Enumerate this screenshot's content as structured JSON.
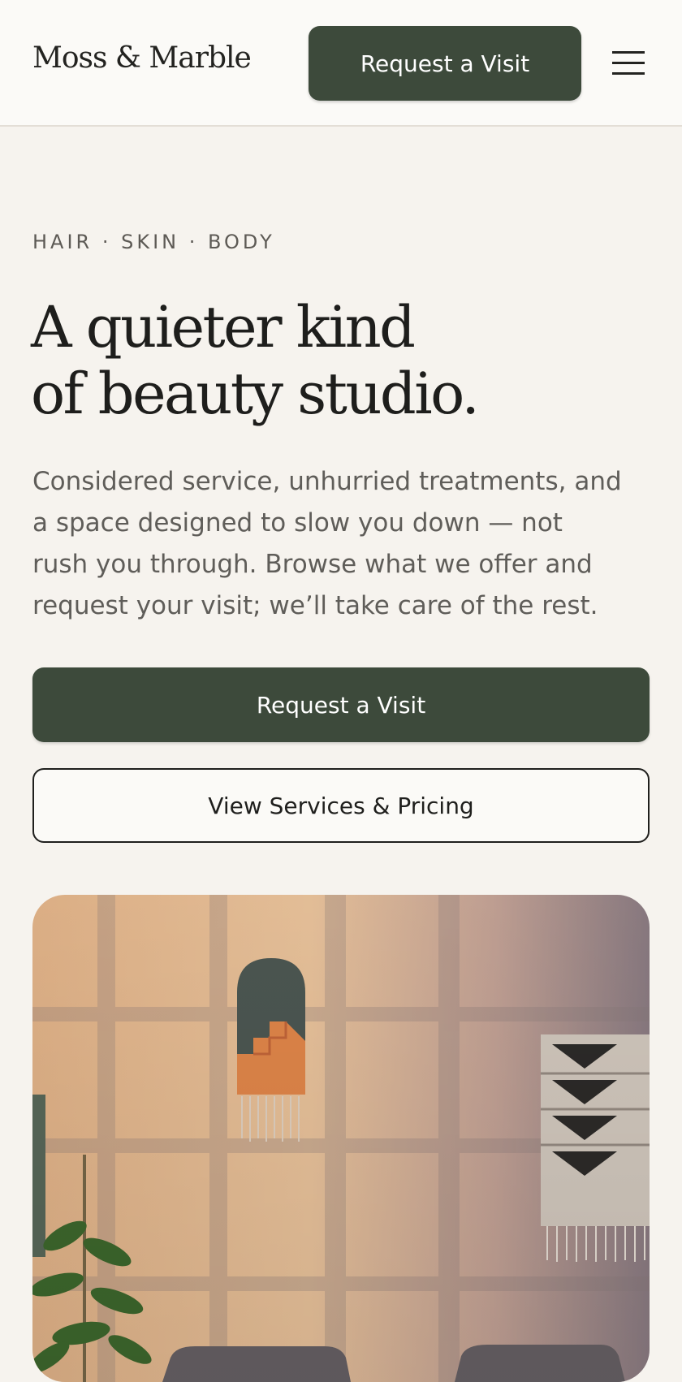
{
  "header": {
    "brand": "Moss & Marble",
    "cta_label": "Request a Visit",
    "menu_icon": "hamburger-menu-icon"
  },
  "hero": {
    "eyebrow": "HAIR · SKIN · BODY",
    "headline_lines": [
      "A quieter kind",
      "of beauty studio."
    ],
    "lede_lines": [
      "Considered service, unhurried treatments, and",
      "a space designed to slow you down — not",
      "rush you through. Browse what we offer and",
      "request your visit; we’ll take care of the rest."
    ],
    "primary_cta": "Request a Visit",
    "secondary_cta": "View Services & Pricing",
    "image": "studio-interior-photo"
  },
  "colors": {
    "accent": "#3d4a3b",
    "page_background": "#f6f3ee",
    "header_background": "#fbfaf7",
    "text": "#1f1f1d",
    "muted_text": "#5f5d59"
  }
}
